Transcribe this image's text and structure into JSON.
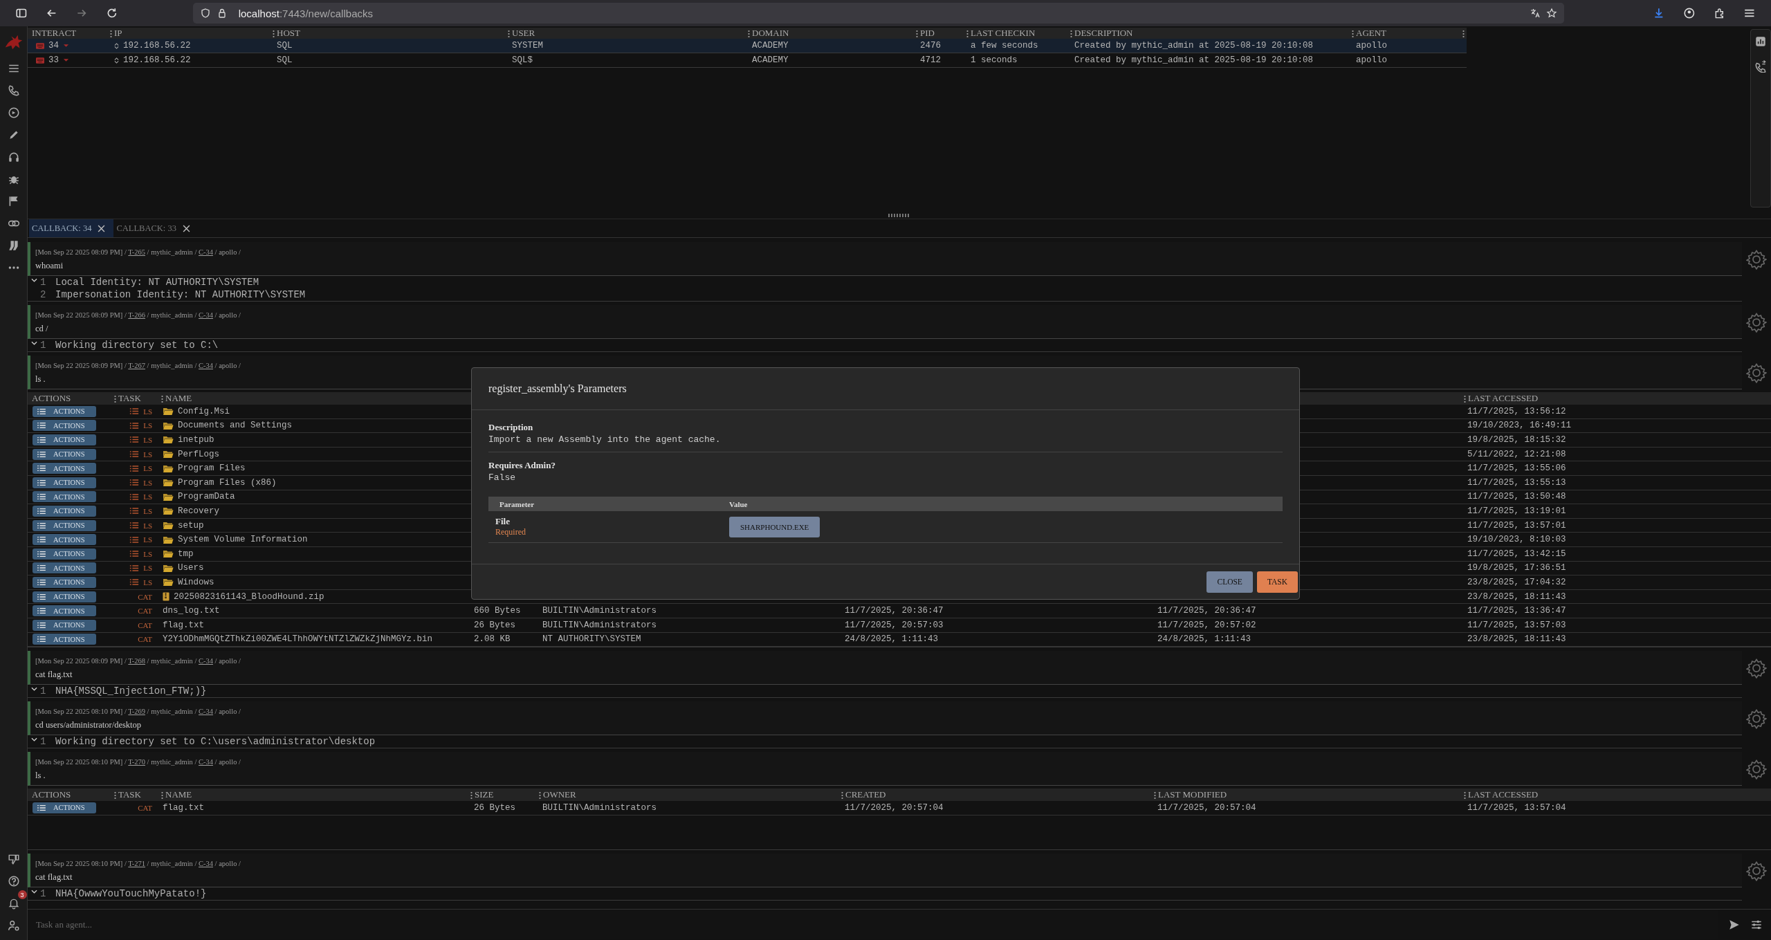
{
  "browser": {
    "host": "localhost",
    "path": ":7443/new/callbacks"
  },
  "callbacks": {
    "columns": [
      "INTERACT",
      "IP",
      "HOST",
      "USER",
      "DOMAIN",
      "PID",
      "LAST CHECKIN",
      "DESCRIPTION",
      "AGENT"
    ],
    "rows": [
      {
        "selected": true,
        "interact": "34",
        "ip": "192.168.56.22",
        "host": "SQL",
        "user": "SYSTEM",
        "domain": "ACADEMY",
        "pid": "2476",
        "last_checkin": "a few seconds",
        "description": "Created by mythic_admin at 2025-08-19 20:10:08",
        "agent": "apollo"
      },
      {
        "selected": false,
        "interact": "33",
        "ip": "192.168.56.22",
        "host": "SQL",
        "user": "SQL$",
        "domain": "ACADEMY",
        "pid": "4712",
        "last_checkin": "1 seconds",
        "description": "Created by mythic_admin at 2025-08-19 20:10:08",
        "agent": "apollo"
      }
    ]
  },
  "tabs": [
    {
      "label": "CALLBACK: 34",
      "selected": true
    },
    {
      "label": "CALLBACK: 33",
      "selected": false
    }
  ],
  "meta_separator": "/",
  "tasks": [
    {
      "meta": {
        "timestamp": "[Mon Sep 22 2025 08:09 PM]",
        "task": "T-265",
        "operator": "mythic_admin",
        "callback": "C-34",
        "agent": "apollo"
      },
      "command": "whoami",
      "output": {
        "kind": "text",
        "lines": [
          {
            "number": "1",
            "text": "Local Identity: NT AUTHORITY\\SYSTEM"
          },
          {
            "number": "2",
            "text": "Impersonation Identity: NT AUTHORITY\\SYSTEM"
          }
        ]
      }
    },
    {
      "meta": {
        "timestamp": "[Mon Sep 22 2025 08:09 PM]",
        "task": "T-266",
        "operator": "mythic_admin",
        "callback": "C-34",
        "agent": "apollo"
      },
      "command": "cd /",
      "output": {
        "kind": "text",
        "lines": [
          {
            "number": "1",
            "text": "Working directory set to C:\\"
          }
        ]
      }
    },
    {
      "meta": {
        "timestamp": "[Mon Sep 22 2025 08:09 PM]",
        "task": "T-267",
        "operator": "mythic_admin",
        "callback": "C-34",
        "agent": "apollo"
      },
      "command": "ls .",
      "output": {
        "kind": "table",
        "header": {
          "actions": "ACTIONS",
          "task": "TASK",
          "name": "NAME",
          "last_accessed": "LAST ACCESSED"
        },
        "rows": [
          {
            "kind": "folder",
            "action": "ACTIONS",
            "task": "LS",
            "name": "Config.Msi",
            "last_accessed": "11/7/2025, 13:56:12"
          },
          {
            "kind": "folder",
            "action": "ACTIONS",
            "task": "LS",
            "name": "Documents and Settings",
            "last_accessed": "19/10/2023, 16:49:11"
          },
          {
            "kind": "folder",
            "action": "ACTIONS",
            "task": "LS",
            "name": "inetpub",
            "last_accessed": "19/8/2025, 18:15:32"
          },
          {
            "kind": "folder",
            "action": "ACTIONS",
            "task": "LS",
            "name": "PerfLogs",
            "last_accessed": "5/11/2022, 12:21:08"
          },
          {
            "kind": "folder",
            "action": "ACTIONS",
            "task": "LS",
            "name": "Program Files",
            "last_accessed": "11/7/2025, 13:55:06"
          },
          {
            "kind": "folder",
            "action": "ACTIONS",
            "task": "LS",
            "name": "Program Files (x86)",
            "last_accessed": "11/7/2025, 13:55:13"
          },
          {
            "kind": "folder",
            "action": "ACTIONS",
            "task": "LS",
            "name": "ProgramData",
            "last_accessed": "11/7/2025, 13:50:48"
          },
          {
            "kind": "folder",
            "action": "ACTIONS",
            "task": "LS",
            "name": "Recovery",
            "last_accessed": "11/7/2025, 13:19:01"
          },
          {
            "kind": "folder",
            "action": "ACTIONS",
            "task": "LS",
            "name": "setup",
            "last_accessed": "11/7/2025, 13:57:01"
          },
          {
            "kind": "folder",
            "action": "ACTIONS",
            "task": "LS",
            "name": "System Volume Information",
            "last_accessed": "19/10/2023, 8:10:03"
          },
          {
            "kind": "folder",
            "action": "ACTIONS",
            "task": "LS",
            "name": "tmp",
            "last_accessed": "11/7/2025, 13:42:15"
          },
          {
            "kind": "folder",
            "action": "ACTIONS",
            "task": "LS",
            "name": "Users",
            "last_accessed": "19/8/2025, 17:36:51"
          },
          {
            "kind": "folder",
            "action": "ACTIONS",
            "task": "LS",
            "name": "Windows",
            "last_accessed": "23/8/2025, 17:04:32"
          },
          {
            "kind": "archive",
            "action": "ACTIONS",
            "task": "CAT",
            "name": "20250823161143_BloodHound.zip",
            "last_accessed": "23/8/2025, 18:11:43"
          },
          {
            "kind": "file",
            "action": "ACTIONS",
            "task": "CAT",
            "name": "dns_log.txt",
            "size": "660 Bytes",
            "owner": "BUILTIN\\Administrators",
            "created": "11/7/2025, 20:36:47",
            "last_modified": "11/7/2025, 20:36:47",
            "last_accessed": "11/7/2025, 13:36:47"
          },
          {
            "kind": "file",
            "action": "ACTIONS",
            "task": "CAT",
            "name": "flag.txt",
            "size": "26 Bytes",
            "owner": "BUILTIN\\Administrators",
            "created": "11/7/2025, 20:57:03",
            "last_modified": "11/7/2025, 20:57:02",
            "last_accessed": "11/7/2025, 13:57:03"
          },
          {
            "kind": "file",
            "action": "ACTIONS",
            "task": "CAT",
            "name": "Y2Y1ODhmMGQtZThkZi00ZWE4LThhOWYtNTZlZWZkZjNhMGYz.bin",
            "size": "2.08 KB",
            "owner": "NT AUTHORITY\\SYSTEM",
            "created": "24/8/2025, 1:11:43",
            "last_modified": "24/8/2025, 1:11:43",
            "last_accessed": "23/8/2025, 18:11:43"
          }
        ]
      }
    },
    {
      "meta": {
        "timestamp": "[Mon Sep 22 2025 08:09 PM]",
        "task": "T-268",
        "operator": "mythic_admin",
        "callback": "C-34",
        "agent": "apollo"
      },
      "command": "cat flag.txt",
      "output": {
        "kind": "text",
        "lines": [
          {
            "number": "1",
            "text": "NHA{MSSQL_Inject1on_FTW;)}"
          }
        ]
      }
    },
    {
      "meta": {
        "timestamp": "[Mon Sep 22 2025 08:10 PM]",
        "task": "T-269",
        "operator": "mythic_admin",
        "callback": "C-34",
        "agent": "apollo"
      },
      "command": "cd users/administrator/desktop",
      "output": {
        "kind": "text",
        "lines": [
          {
            "number": "1",
            "text": "Working directory set to C:\\users\\administrator\\desktop"
          }
        ]
      }
    },
    {
      "meta": {
        "timestamp": "[Mon Sep 22 2025 08:10 PM]",
        "task": "T-270",
        "operator": "mythic_admin",
        "callback": "C-34",
        "agent": "apollo"
      },
      "command": "ls .",
      "output": {
        "kind": "table",
        "header": {
          "actions": "ACTIONS",
          "task": "TASK",
          "name": "NAME",
          "size": "SIZE",
          "owner": "OWNER",
          "created": "CREATED",
          "last_modified": "LAST MODIFIED",
          "last_accessed": "LAST ACCESSED"
        },
        "rows": [
          {
            "kind": "file",
            "action": "ACTIONS",
            "task": "CAT",
            "name": "flag.txt",
            "size": "26 Bytes",
            "owner": "BUILTIN\\Administrators",
            "created": "11/7/2025, 20:57:04",
            "last_modified": "11/7/2025, 20:57:04",
            "last_accessed": "11/7/2025, 13:57:04"
          }
        ]
      }
    },
    {
      "meta": {
        "timestamp": "[Mon Sep 22 2025 08:10 PM]",
        "task": "T-271",
        "operator": "mythic_admin",
        "callback": "C-34",
        "agent": "apollo"
      },
      "command": "cat flag.txt",
      "output": {
        "kind": "text",
        "lines": [
          {
            "number": "1",
            "text": "NHA{OwwwYouTouchMyPatato!}"
          }
        ]
      }
    }
  ],
  "input": {
    "placeholder": "Task an agent..."
  },
  "notifications": {
    "count": "3"
  },
  "modal": {
    "title": "register_assembly's Parameters",
    "description_label": "Description",
    "description": "Import a new Assembly into the agent cache.",
    "admin_label": "Requires Admin?",
    "admin_value": "False",
    "columns": [
      "Parameter",
      "Value"
    ],
    "params": [
      {
        "name": "File",
        "note": "Required",
        "value": "SHARPHOUND.EXE"
      }
    ],
    "buttons": [
      {
        "label": "CLOSE",
        "kind": "secondary"
      },
      {
        "label": "TASK",
        "kind": "primary"
      }
    ]
  }
}
